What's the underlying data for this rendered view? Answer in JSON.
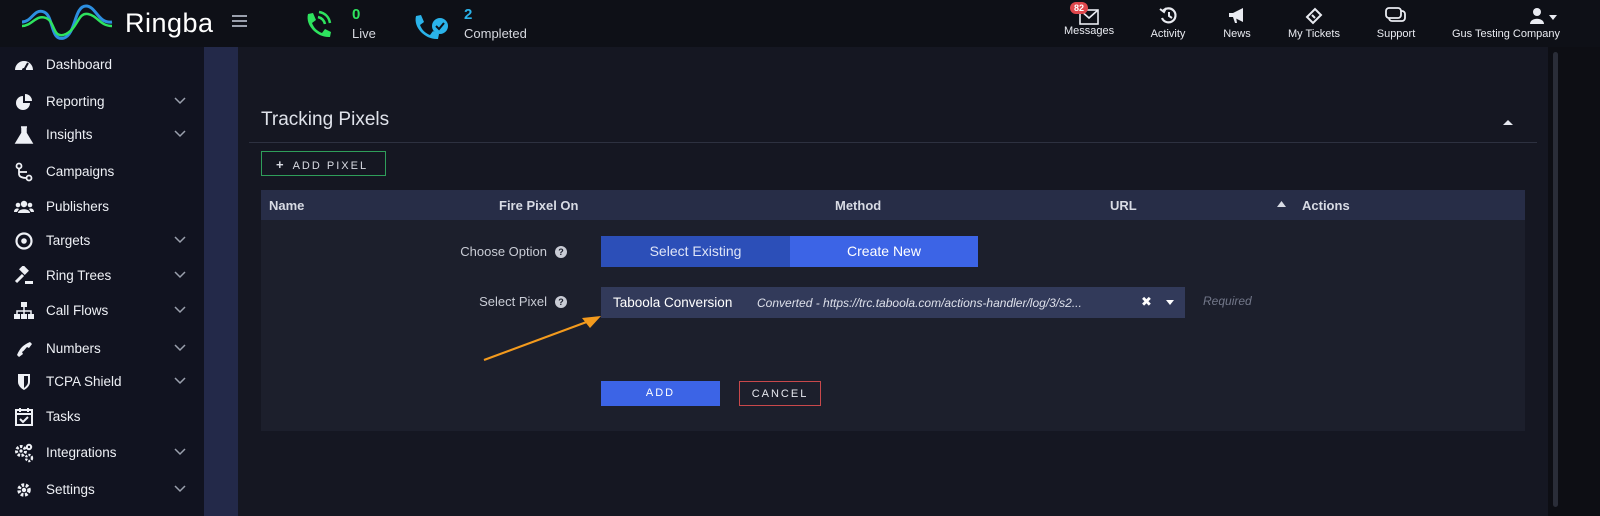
{
  "brand": {
    "name": "Ringba"
  },
  "stats": {
    "live": {
      "count": "0",
      "label": "Live"
    },
    "completed": {
      "count": "2",
      "label": "Completed"
    }
  },
  "topnav": {
    "messages": {
      "label": "Messages",
      "badge": "82",
      "icon": "envelope-icon"
    },
    "activity": {
      "label": "Activity",
      "icon": "history-icon"
    },
    "news": {
      "label": "News",
      "icon": "megaphone-icon"
    },
    "tickets": {
      "label": "My Tickets",
      "icon": "ticket-icon"
    },
    "support": {
      "label": "Support",
      "icon": "chat-icon"
    },
    "account": {
      "label": "Gus Testing Company",
      "icon": "user-icon"
    }
  },
  "sidebar": {
    "items": [
      {
        "label": "Dashboard",
        "icon": "dashboard-icon"
      },
      {
        "label": "Reporting",
        "icon": "pie-chart-icon"
      },
      {
        "label": "Insights",
        "icon": "flask-icon"
      },
      {
        "label": "Campaigns",
        "icon": "campaign-branch-icon"
      },
      {
        "label": "Publishers",
        "icon": "users-icon"
      },
      {
        "label": "Targets",
        "icon": "target-icon"
      },
      {
        "label": "Ring Trees",
        "icon": "gavel-icon"
      },
      {
        "label": "Call Flows",
        "icon": "sitemap-icon"
      },
      {
        "label": "Numbers",
        "icon": "phone-icon"
      },
      {
        "label": "TCPA Shield",
        "icon": "shield-icon"
      },
      {
        "label": "Tasks",
        "icon": "calendar-check-icon"
      },
      {
        "label": "Integrations",
        "icon": "cogs-icon"
      },
      {
        "label": "Settings",
        "icon": "gear-icon"
      }
    ]
  },
  "main": {
    "section_title": "Tracking Pixels",
    "add_pixel_label": "ADD PIXEL",
    "columns": [
      "Name",
      "Fire Pixel On",
      "Method",
      "URL",
      "Actions"
    ],
    "form": {
      "choose_option_label": "Choose Option",
      "option_select_existing": "Select Existing",
      "option_create_new": "Create New",
      "select_pixel_label": "Select Pixel",
      "selected_pixel_name": "Taboola Conversion",
      "selected_pixel_detail": "Converted - https://trc.taboola.com/actions-handler/log/3/s2...",
      "required_hint": "Required",
      "add_button": "ADD",
      "cancel_button": "CANCEL"
    }
  },
  "colors": {
    "accent_blue": "#3c64e6",
    "live_green": "#2ee35e",
    "completed_blue": "#2ab3ea",
    "cancel_red": "#c8484b",
    "add_pixel_border": "#2f9e5a",
    "annotation_arrow": "#f39a1d"
  }
}
